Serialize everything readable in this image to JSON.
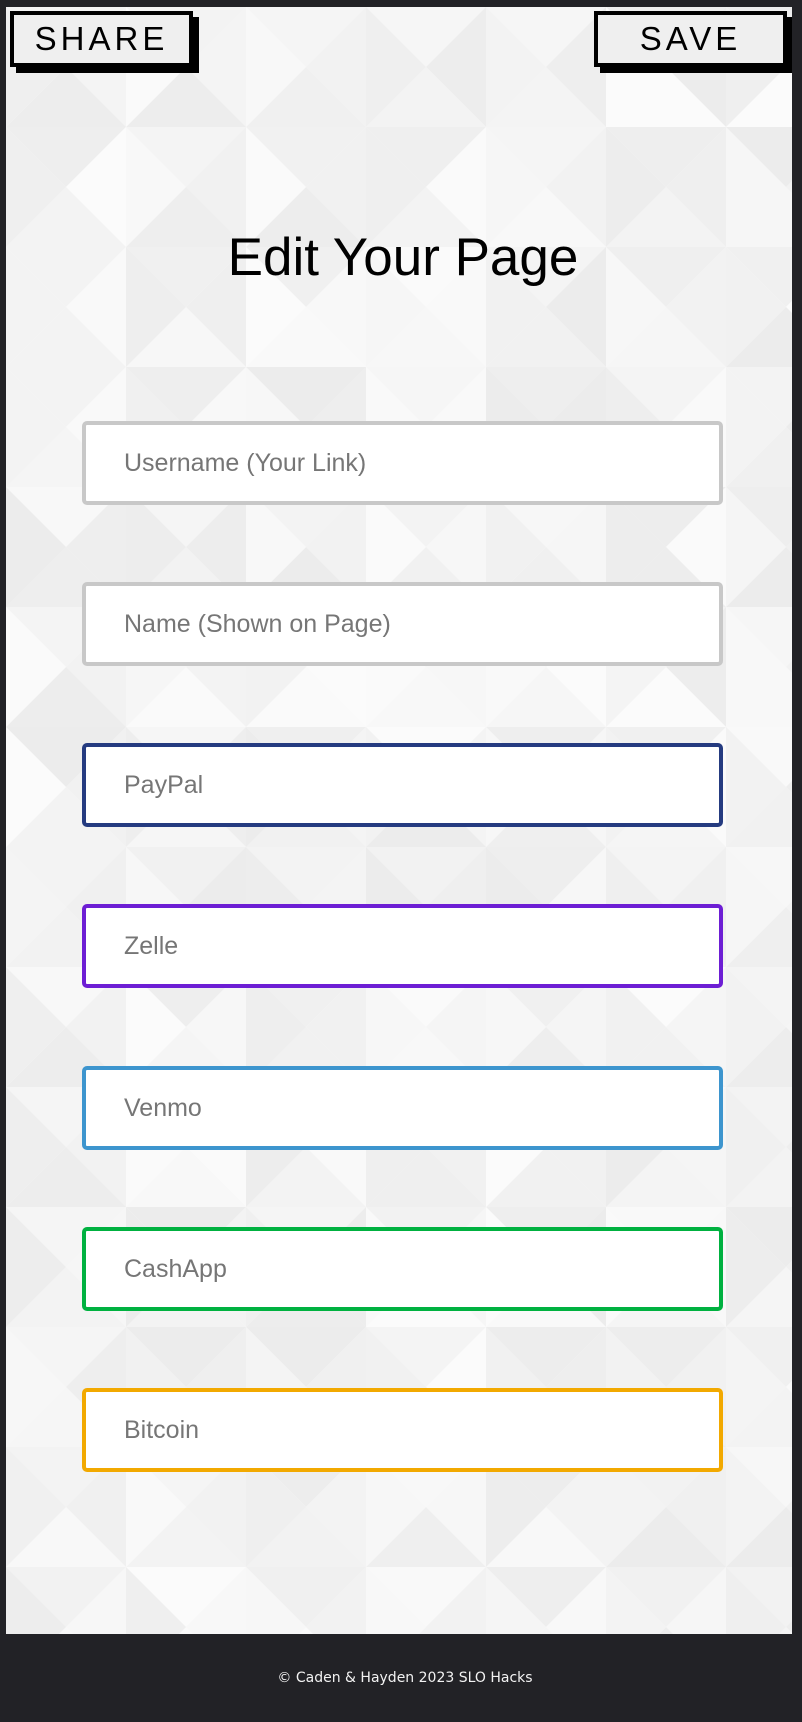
{
  "header": {
    "share_label": "SHARE",
    "save_label": "SAVE"
  },
  "page": {
    "title": "Edit Your Page"
  },
  "fields": [
    {
      "key": "username",
      "placeholder": "Username (Your Link)",
      "value": "",
      "border_color": "#c8c8c8"
    },
    {
      "key": "name",
      "placeholder": "Name (Shown on Page)",
      "value": "",
      "border_color": "#c8c8c8"
    },
    {
      "key": "paypal",
      "placeholder": "PayPal",
      "value": "",
      "border_color": "#253b80"
    },
    {
      "key": "zelle",
      "placeholder": "Zelle",
      "value": "",
      "border_color": "#6d1ed4"
    },
    {
      "key": "venmo",
      "placeholder": "Venmo",
      "value": "",
      "border_color": "#3d95ce"
    },
    {
      "key": "cashapp",
      "placeholder": "CashApp",
      "value": "",
      "border_color": "#00b140"
    },
    {
      "key": "bitcoin",
      "placeholder": "Bitcoin",
      "value": "",
      "border_color": "#f2a900"
    }
  ],
  "footer": {
    "text": "© Caden & Hayden 2023 SLO Hacks"
  },
  "colors": {
    "page_background": "#f8f8f8",
    "frame_border": "#222226",
    "button_background": "#efefef"
  }
}
